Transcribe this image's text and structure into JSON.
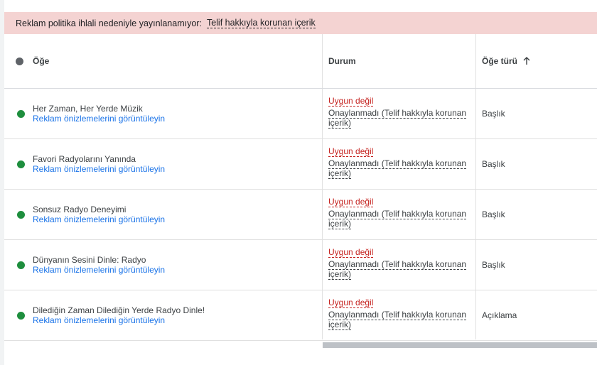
{
  "banner": {
    "text": "Reklam politika ihlali nedeniyle yayınlanamıyor:",
    "link": "Telif hakkıyla korunan içerik"
  },
  "columns": {
    "item": "Öğe",
    "status": "Durum",
    "item_type": "Öğe türü"
  },
  "rows": [
    {
      "name": "Her Zaman, Her Yerde Müzik",
      "preview": "Reklam önizlemelerini görüntüleyin",
      "status": "Uygun değil",
      "reason": "Onaylanmadı (Telif hakkıyla korunan içerik)",
      "type": "Başlık"
    },
    {
      "name": "Favori Radyolarını Yanında",
      "preview": "Reklam önizlemelerini görüntüleyin",
      "status": "Uygun değil",
      "reason": "Onaylanmadı (Telif hakkıyla korunan içerik)",
      "type": "Başlık"
    },
    {
      "name": "Sonsuz Radyo Deneyimi",
      "preview": "Reklam önizlemelerini görüntüleyin",
      "status": "Uygun değil",
      "reason": "Onaylanmadı (Telif hakkıyla korunan içerik)",
      "type": "Başlık"
    },
    {
      "name": "Dünyanın Sesini Dinle: Radyo",
      "preview": "Reklam önizlemelerini görüntüleyin",
      "status": "Uygun değil",
      "reason": "Onaylanmadı (Telif hakkıyla korunan içerik)",
      "type": "Başlık"
    },
    {
      "name": "Dilediğin Zaman Dilediğin Yerde Radyo Dinle!",
      "preview": "Reklam önizlemelerini görüntüleyin",
      "status": "Uygun değil",
      "reason": "Onaylanmadı (Telif hakkıyla korunan içerik)",
      "type": "Açıklama"
    }
  ],
  "colors": {
    "banner_bg": "#f4d3d2",
    "status_dot": "#1e8e3e",
    "link": "#1a73e8",
    "status_text": "#c5221f"
  },
  "icons": {
    "sort": "arrow-up-icon",
    "header_status": "status-dot-icon"
  }
}
